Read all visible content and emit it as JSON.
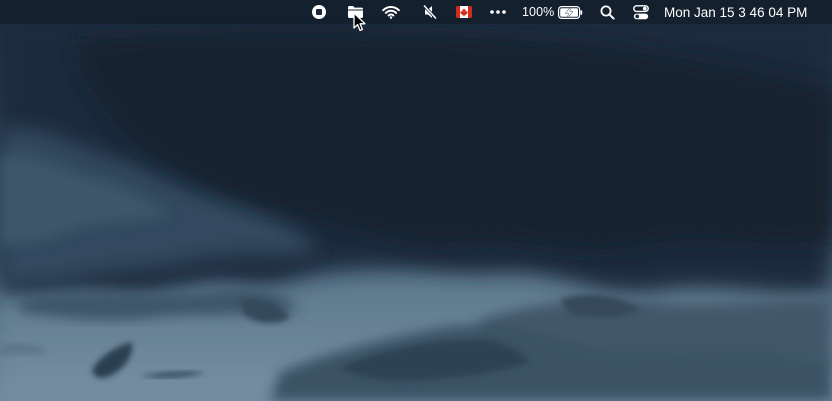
{
  "desktop": {
    "wallpaper": "stormy-clouds-wallpaper",
    "colors": {
      "sky_dark": "#1b2a3a",
      "sky_mid": "#324a5e",
      "sky_light": "#5d7a90",
      "horizon": "#7e98ab"
    }
  },
  "menubar": {
    "status_items": [
      {
        "icon": "record-stop-icon"
      },
      {
        "icon": "folder-icon"
      },
      {
        "icon": "wifi-icon"
      },
      {
        "icon": "speaker-muted-icon"
      },
      {
        "icon": "canada-flag-icon"
      },
      {
        "icon": "more-dots-icon"
      }
    ],
    "battery": {
      "percent_label": "100%",
      "level": 1.0,
      "charging": true,
      "icon": "battery-charging-icon"
    },
    "spotlight_icon": "search-icon",
    "control_center_icon": "control-center-icon",
    "clock": {
      "label": "Mon Jan 15  3 46 04 PM"
    }
  },
  "cursor": {
    "icon": "pointer-cursor-icon"
  }
}
